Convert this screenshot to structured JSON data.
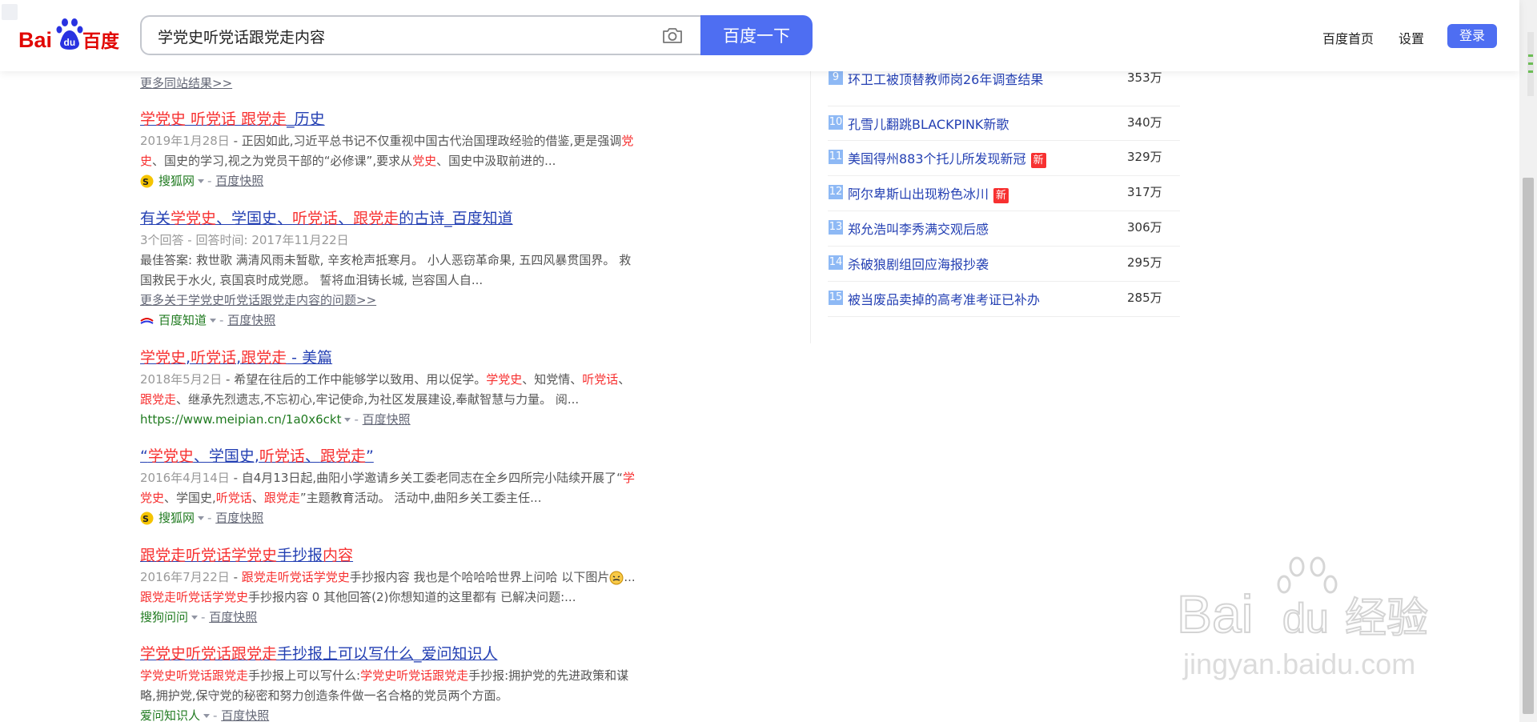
{
  "header": {
    "logo_text_left": "Bai",
    "logo_text_paw": "du",
    "logo_text_right": "百度",
    "search_value": "学党史听党话跟党走内容",
    "search_button": "百度一下",
    "links": [
      "百度首页",
      "设置"
    ],
    "login": "登录"
  },
  "results": {
    "more_same_site": "更多同站结果>>",
    "items": [
      {
        "title_parts": [
          "学党史 听党话 跟党走",
          "_历史"
        ],
        "date": "2019年1月28日",
        "snippet_line1": " - 正因如此,习近平总书记不仅重视中国古代治国理政经验的借鉴,更是强调",
        "hl1": "党",
        "hl2": "史",
        "snippet_line2": "、国史的学习,视之为党员干部的“必修课”,要求从",
        "hl3": "党史",
        "snippet_line3": "、国史中汲取前进的...",
        "source": "搜狐网",
        "kuaizhao": "百度快照"
      },
      {
        "title_parts": [
          "有关",
          "学党史",
          "、学国史、",
          "听党话",
          "、",
          "跟党走",
          "的古诗_百度知道"
        ],
        "meta": "3个回答 - 回答时间: 2017年11月22日",
        "snippet_line1": "最佳答案: 救世歌 满清风雨未暂歇, 辛亥枪声抵寒月。 小人恶窃革命果, 五四风暴贯国界。 救",
        "snippet_line2": "国救民于水火, 哀国哀时成党愿。 誓将血泪铸长城, 岂容国人自...",
        "more": "更多关于学党史听党话跟党走内容的问题>>",
        "source": "百度知道",
        "kuaizhao": "百度快照"
      },
      {
        "title_parts": [
          "学党史",
          ",",
          "听党话",
          ",",
          "跟党走",
          " - 美篇"
        ],
        "date": "2018年5月2日",
        "snippet_line1": " - 希望在往后的工作中能够学以致用、用以促学。",
        "hl_a": "学党史",
        "mid_a": "、知党情、",
        "hl_b": "听党话",
        "end_a": "、",
        "hl_c": "跟党走",
        "snippet_line2": "、继承先烈遗志,不忘初心,牢记使命,为社区发展建设,奉献智慧与力量。 阅...",
        "url": "https://www.meipian.cn/1a0x6ckt",
        "kuaizhao": "百度快照"
      },
      {
        "title_parts": [
          "“",
          "学党史",
          "、学国史,",
          "听党话",
          "、",
          "跟党走",
          "”"
        ],
        "date": "2016年4月14日",
        "snippet_line1": " - 自4月13日起,曲阳小学邀请乡关工委老同志在全乡四所完小陆续开展了“",
        "hl_a": "学",
        "hl_b": "党史",
        "mid_a": "、学国史,",
        "hl_c": "听党话",
        "mid_b": "、",
        "hl_d": "跟党走",
        "snippet_line2": "”主题教育活动。 活动中,曲阳乡关工委主任...",
        "source": "搜狐网",
        "kuaizhao": "百度快照"
      },
      {
        "title_parts": [
          "跟党走听党话学党史",
          "手抄报",
          "内容"
        ],
        "date": "2016年7月22日",
        "hl_a": "跟党走听党话学党史",
        "snippet_line1": "手抄报内容 我也是个哈哈哈世界上问哈 以下图片",
        "ellipsis": "...",
        "hl_b": "跟党走听党话学党史",
        "snippet_line2": "手抄报内容 0 其他回答(2)你想知道的这里都有 已解决问题:...",
        "source": "搜狗问问",
        "kuaizhao": "百度快照"
      },
      {
        "title_parts": [
          "学党史听党话跟党走",
          "手抄报上可以写什么_爱问知识人"
        ],
        "hl_a": "学党史听党话跟党走",
        "snippet_line1": "手抄报上可以写什么:",
        "hl_b": "学党史听党话跟党走",
        "snippet_line1b": "手抄报:拥护党的先进政策和谋",
        "snippet_line2": "略,拥护党,保守党的秘密和努力创造条件做一名合格的党员两个方面。",
        "source": "爱问知识人",
        "kuaizhao": "百度快照"
      }
    ]
  },
  "hot_list": [
    {
      "num": "9",
      "text": "环卫工被顶替教师岗26年调查结果",
      "count": "353万",
      "new": ""
    },
    {
      "num": "10",
      "text": "孔雪儿翻跳BLACKPINK新歌",
      "count": "340万",
      "new": ""
    },
    {
      "num": "11",
      "text": "美国得州883个托儿所发现新冠",
      "count": "329万",
      "new": "新"
    },
    {
      "num": "12",
      "text": "阿尔卑斯山出现粉色冰川",
      "count": "317万",
      "new": "新"
    },
    {
      "num": "13",
      "text": "郑允浩叫李秀满交观后感",
      "count": "306万",
      "new": ""
    },
    {
      "num": "14",
      "text": "杀破狼剧组回应海报抄袭",
      "count": "295万",
      "new": ""
    },
    {
      "num": "15",
      "text": "被当废品卖掉的高考准考证已补办",
      "count": "285万",
      "new": ""
    }
  ],
  "watermark": {
    "brand": "Bai",
    "brand2": "du",
    "cn": "经验",
    "url": "jingyan.baidu.com"
  },
  "colors": {
    "accent": "#4e6ef2",
    "link": "#2440b3",
    "highlight": "#f73131",
    "source_green": "#1f7a1f"
  }
}
